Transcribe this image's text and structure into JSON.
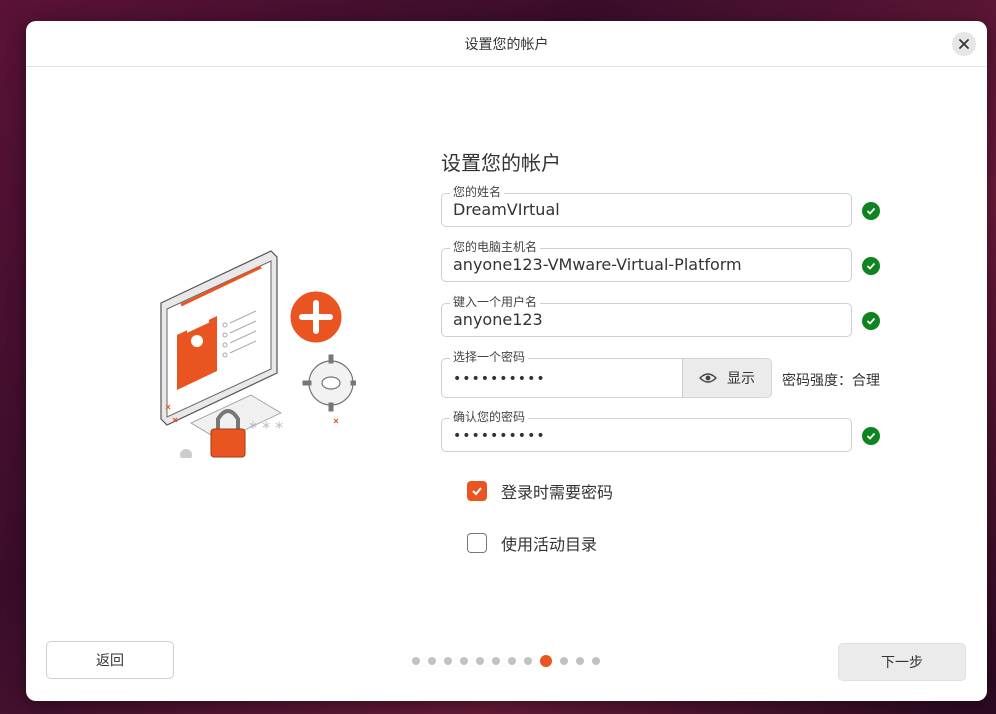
{
  "window": {
    "title": "设置您的帐户"
  },
  "form": {
    "heading": "设置您的帐户",
    "name": {
      "label": "您的姓名",
      "value": "DreamVIrtual"
    },
    "hostname": {
      "label": "您的电脑主机名",
      "value": "anyone123-VMware-Virtual-Platform"
    },
    "username": {
      "label": "键入一个用户名",
      "value": "anyone123"
    },
    "password": {
      "label": "选择一个密码",
      "value": "••••••••••",
      "show_label": "显示",
      "strength": "密码强度：合理"
    },
    "confirm": {
      "label": "确认您的密码",
      "value": "••••••••••"
    },
    "require_password": {
      "label": "登录时需要密码",
      "checked": true
    },
    "active_directory": {
      "label": "使用活动目录",
      "checked": false
    }
  },
  "nav": {
    "back_label": "返回",
    "next_label": "下一步",
    "total_steps": 12,
    "current_step": 9
  },
  "colors": {
    "accent": "#e95420",
    "ok": "#0e8420"
  },
  "icons": [
    "close-icon",
    "check-icon",
    "eye-icon",
    "account-illustration"
  ]
}
